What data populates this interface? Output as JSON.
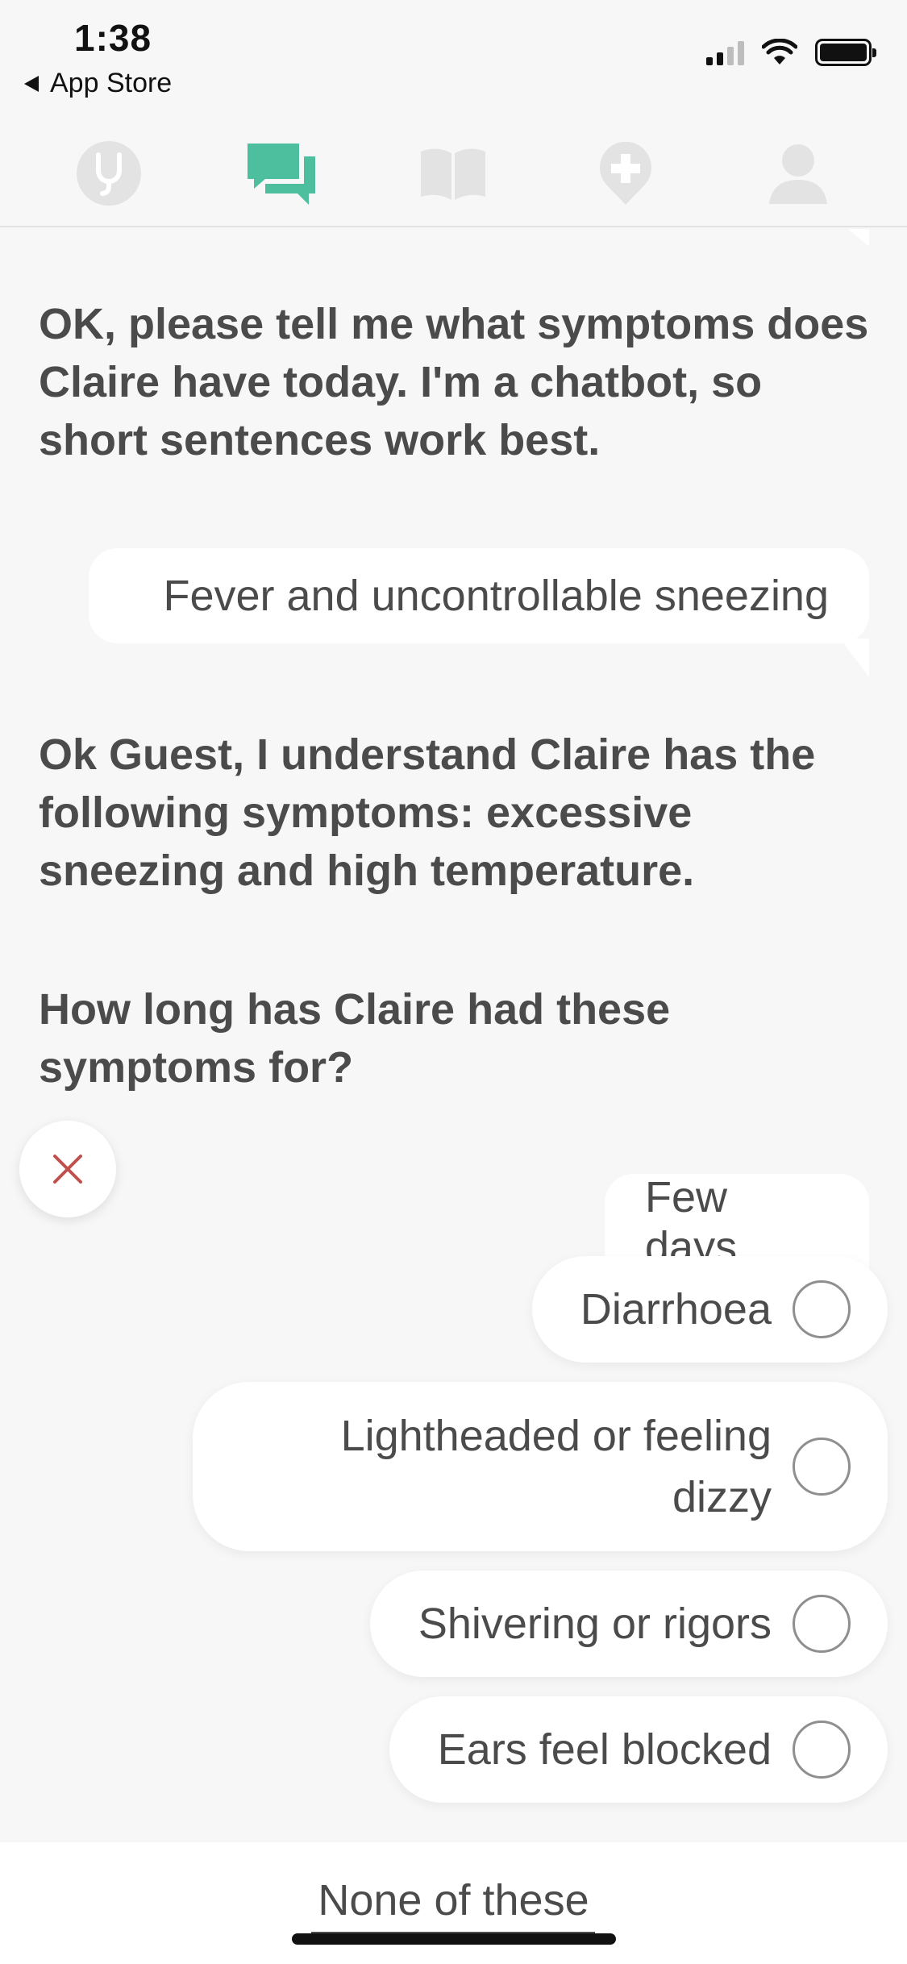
{
  "status_bar": {
    "time": "1:38",
    "back_label": "App Store",
    "icons": [
      "signal-icon",
      "wifi-icon",
      "battery-icon"
    ]
  },
  "tabs": [
    {
      "name": "stethoscope-icon",
      "active": false
    },
    {
      "name": "chat-icon",
      "active": true
    },
    {
      "name": "book-icon",
      "active": false
    },
    {
      "name": "health-pin-icon",
      "active": false
    },
    {
      "name": "profile-icon",
      "active": false
    }
  ],
  "colors": {
    "accent": "#4dbf9e",
    "inactive_icon": "#e3e3e3",
    "close_x": "#c0504d",
    "text": "#4b4b4b",
    "background": "#f7f7f7"
  },
  "messages": {
    "bot_1": "OK, please tell me what symptoms does Claire have today. I'm a chatbot, so short sentences work best.",
    "user_1": "Fever and uncontrollable sneezing",
    "bot_2": "Ok Guest, I understand Claire has the following symptoms: excessive sneezing and high temperature.",
    "bot_3": "How long has Claire had these symptoms for?",
    "user_2": "Few days"
  },
  "options": [
    {
      "label": "Diarrhoea",
      "selected": false
    },
    {
      "label": "Lightheaded or feeling dizzy",
      "selected": false
    },
    {
      "label": "Shivering or rigors",
      "selected": false
    },
    {
      "label": "Ears feel blocked",
      "selected": false
    }
  ],
  "footer": {
    "none_label": "None of these"
  }
}
